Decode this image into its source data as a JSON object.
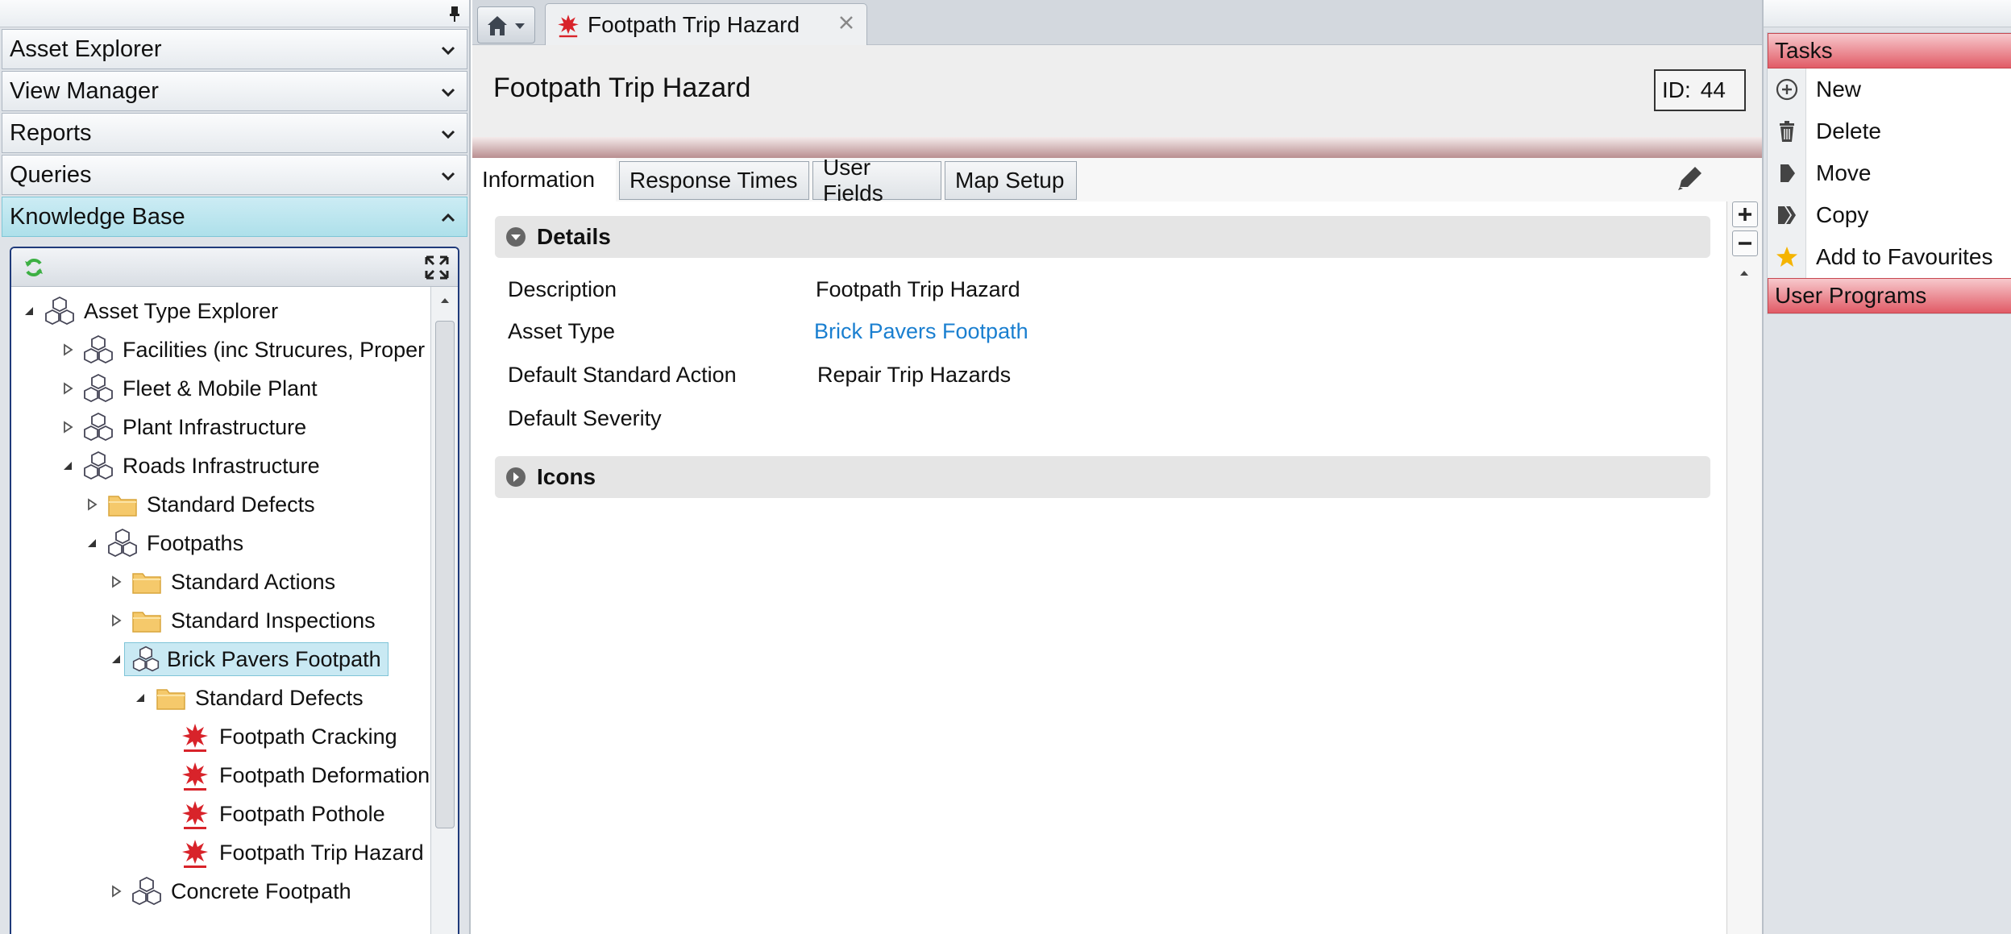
{
  "left_panel": {
    "accordions": [
      {
        "label": "Asset Explorer",
        "expanded": false
      },
      {
        "label": "View Manager",
        "expanded": false
      },
      {
        "label": "Reports",
        "expanded": false
      },
      {
        "label": "Queries",
        "expanded": false
      },
      {
        "label": "Knowledge Base",
        "expanded": true
      }
    ],
    "tree": {
      "root": "Asset Type Explorer",
      "nodes": [
        {
          "label": "Facilities (inc Strucures, Proper",
          "icon": "asset-type-icon",
          "state": "collapsed"
        },
        {
          "label": "Fleet & Mobile Plant",
          "icon": "asset-type-icon",
          "state": "collapsed"
        },
        {
          "label": "Plant Infrastructure",
          "icon": "asset-type-icon",
          "state": "collapsed"
        },
        {
          "label": "Roads Infrastructure",
          "icon": "asset-type-icon",
          "state": "expanded"
        },
        {
          "label": "Standard Defects",
          "icon": "folder-icon",
          "state": "collapsed"
        },
        {
          "label": "Footpaths",
          "icon": "asset-type-icon",
          "state": "expanded"
        },
        {
          "label": "Standard Actions",
          "icon": "folder-icon",
          "state": "collapsed"
        },
        {
          "label": "Standard Inspections",
          "icon": "folder-icon",
          "state": "collapsed"
        },
        {
          "label": "Brick Pavers Footpath",
          "icon": "asset-type-icon",
          "state": "expanded",
          "selected": true
        },
        {
          "label": "Standard Defects",
          "icon": "folder-icon",
          "state": "expanded"
        },
        {
          "label": "Footpath Cracking",
          "icon": "defect-icon",
          "state": "leaf"
        },
        {
          "label": "Footpath Deformation",
          "icon": "defect-icon",
          "state": "leaf"
        },
        {
          "label": "Footpath Pothole",
          "icon": "defect-icon",
          "state": "leaf"
        },
        {
          "label": "Footpath Trip Hazard",
          "icon": "defect-icon",
          "state": "leaf"
        },
        {
          "label": "Concrete Footpath",
          "icon": "asset-type-icon",
          "state": "collapsed"
        }
      ]
    }
  },
  "document_tab": {
    "label": "Footpath Trip Hazard"
  },
  "record": {
    "title": "Footpath Trip Hazard",
    "id_label": "ID:",
    "id_value": "44"
  },
  "tabs": [
    "Information",
    "Response Times",
    "User Fields",
    "Map Setup"
  ],
  "sections": {
    "details": {
      "title": "Details",
      "fields": [
        {
          "label": "Description",
          "value": "Footpath Trip Hazard"
        },
        {
          "label": "Asset Type",
          "value": "Brick Pavers Footpath"
        },
        {
          "label": "Default Standard Action",
          "value": "Repair Trip Hazards"
        },
        {
          "label": "Default Severity",
          "value": ""
        }
      ]
    },
    "icons": {
      "title": "Icons"
    }
  },
  "right_panel": {
    "tasks_title": "Tasks",
    "tasks": [
      {
        "label": "New",
        "icon": "plus-circle-icon"
      },
      {
        "label": "Delete",
        "icon": "trash-icon"
      },
      {
        "label": "Move",
        "icon": "move-icon"
      },
      {
        "label": "Copy",
        "icon": "copy-icon"
      },
      {
        "label": "Add to Favourites",
        "icon": "star-icon"
      }
    ],
    "user_programs_title": "User Programs"
  },
  "colors": {
    "accent_red": "#e15b66",
    "link_blue": "#1a7fd0",
    "selection": "#c9e9f3"
  }
}
